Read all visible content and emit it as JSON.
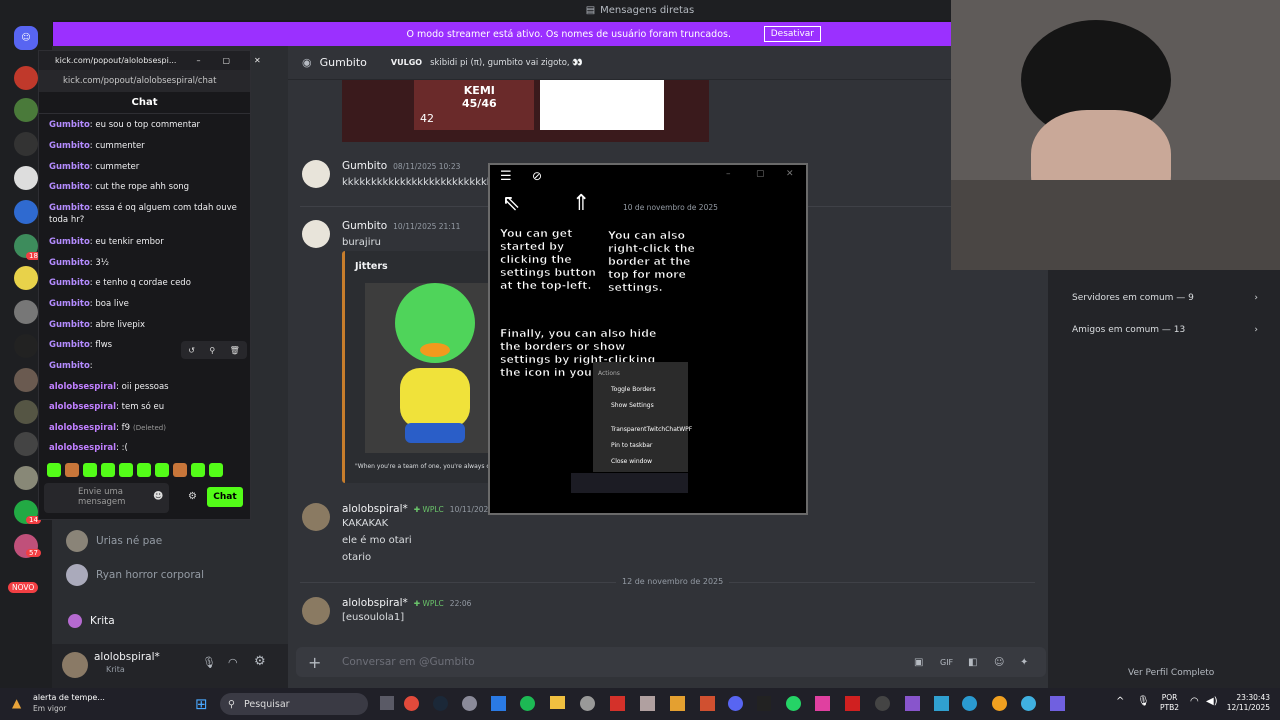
{
  "topbar": {
    "title": "Mensagens diretas"
  },
  "streamer": {
    "text": "O modo streamer está ativo. Os nomes de usuário foram truncados.",
    "button": "Desativar"
  },
  "rail": {
    "badges": [
      "18",
      "14",
      "57"
    ],
    "novo": "NOVO"
  },
  "sidebar": {
    "dms": [
      {
        "name": "Urias né pae"
      },
      {
        "name": "Ryan horror corporal"
      }
    ],
    "activity": {
      "label": "Krita"
    },
    "user": {
      "name": "alolobspiral*",
      "status": "Krita"
    }
  },
  "chat_header": {
    "name": "Gumbito",
    "vulgo_tag": "VULGO",
    "status": "skibidi pi (π), gumbito vai zigoto, 👀"
  },
  "embed_top": {
    "label": "KEMI",
    "score": "45/46",
    "num": "42"
  },
  "messages": [
    {
      "author": "Gumbito",
      "time": "08/11/2025 10:23",
      "text": "kkkkkkkkkkkkkkkkkkkkkkkkkkk"
    },
    {
      "author": "Gumbito",
      "time": "10/11/2025 21:11",
      "text": "burajiru"
    },
    {
      "author": "alolobspiral*",
      "tag": "WPLC",
      "time": "10/11/2025 21:11",
      "lines": [
        "KAKAKAK",
        "ele é mo otari",
        "otario"
      ]
    },
    {
      "author": "alolobspiral*",
      "tag": "WPLC",
      "time": "22:06",
      "text": "[eusoulola1]"
    }
  ],
  "embed": {
    "title": "Jitters",
    "caption": "\"When you're a team of one, you're always captain!\""
  },
  "dividers": [
    "10 de novembro de 2025",
    "12 de novembro de 2025"
  ],
  "composer": {
    "placeholder": "Conversar em @Gumbito"
  },
  "right_panel": {
    "mutual_servers": "Servidores em comum — 9",
    "mutual_friends": "Amigos em comum — 13",
    "footer": "Ver Perfil Completo"
  },
  "kick": {
    "window_title": "kick.com/popout/alolobsespi...",
    "url": "kick.com/popout/alolobsespiral/chat",
    "header": "Chat",
    "lines": [
      {
        "user": "Gumbito",
        "text": "eu sou o top commentar"
      },
      {
        "user": "Gumbito",
        "text": "cummenter"
      },
      {
        "user": "Gumbito",
        "text": "cummeter"
      },
      {
        "user": "Gumbito",
        "text": "cut the rope ahh song"
      },
      {
        "user": "Gumbito",
        "text": "essa é oq alguem com tdah ouve toda hr?"
      },
      {
        "user": "Gumbito",
        "text": "eu tenkir embor"
      },
      {
        "user": "Gumbito",
        "text": "3½"
      },
      {
        "user": "Gumbito",
        "text": "e tenho q cordae cedo"
      },
      {
        "user": "Gumbito",
        "text": "boa live"
      },
      {
        "user": "Gumbito",
        "text": "abre livepix"
      },
      {
        "user": "Gumbito",
        "text": "flws"
      },
      {
        "user": "Gumbito",
        "text": ""
      },
      {
        "user": "alolobsespiral",
        "text": "oii pessoas"
      },
      {
        "user": "alolobsespiral",
        "text": "tem só eu"
      },
      {
        "user": "alolobsespiral",
        "text": "f9",
        "deleted": "(Deleted)"
      },
      {
        "user": "alolobsespiral",
        "text": ":("
      }
    ],
    "input_placeholder": "Envie uma mensagem",
    "send": "Chat"
  },
  "overlay": {
    "date": "10 de novembro de 2025",
    "tip1": "You can get started by clicking the settings button at the top-left.",
    "tip2": "You can also right-click the border at the top for more settings.",
    "tip3": "Finally, you can also hide the borders or show settings by right-clicking the icon in your taskbar.",
    "menu_title": "Actions",
    "menu": [
      "Toggle Borders",
      "Show Settings",
      "TransparentTwitchChatWPF",
      "Pin to taskbar",
      "Close window"
    ]
  },
  "taskbar": {
    "weather_title": "alerta de tempe...",
    "weather_sub": "Em vigor",
    "search": "Pesquisar",
    "lang1": "POR",
    "lang2": "PTB2",
    "time": "23:30:43",
    "date": "12/11/2025"
  },
  "colors": {
    "accent": "#9b30ff",
    "kick_green": "#53fc18",
    "discord_bg": "#313338"
  }
}
